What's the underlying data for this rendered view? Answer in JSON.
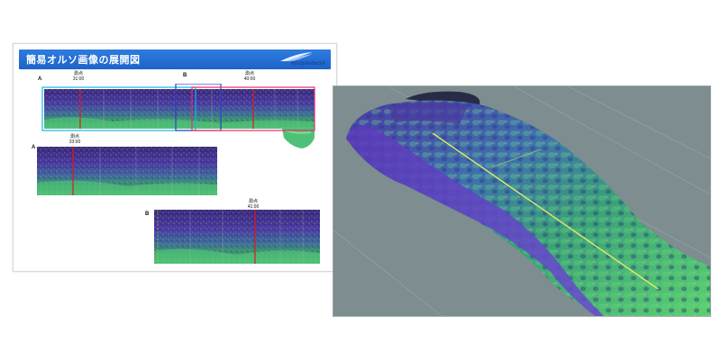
{
  "slide": {
    "title": "簡易オルソ画像の展開図",
    "logo": "WindyNetwork",
    "strips": [
      {
        "row_label": "A",
        "markers": [
          {
            "label": "測点",
            "value": "31:00"
          },
          {
            "label": "測点",
            "value": "40:00"
          }
        ],
        "mid_label": "B"
      },
      {
        "row_label": "A",
        "markers": [
          {
            "label": "測点",
            "value": "33:00"
          }
        ]
      },
      {
        "row_label": "B",
        "markers": [
          {
            "label": "測点",
            "value": "41:00"
          }
        ]
      }
    ]
  },
  "view3d": {
    "background_color": "#7e8d8f",
    "line_color": "#d6e05a"
  }
}
